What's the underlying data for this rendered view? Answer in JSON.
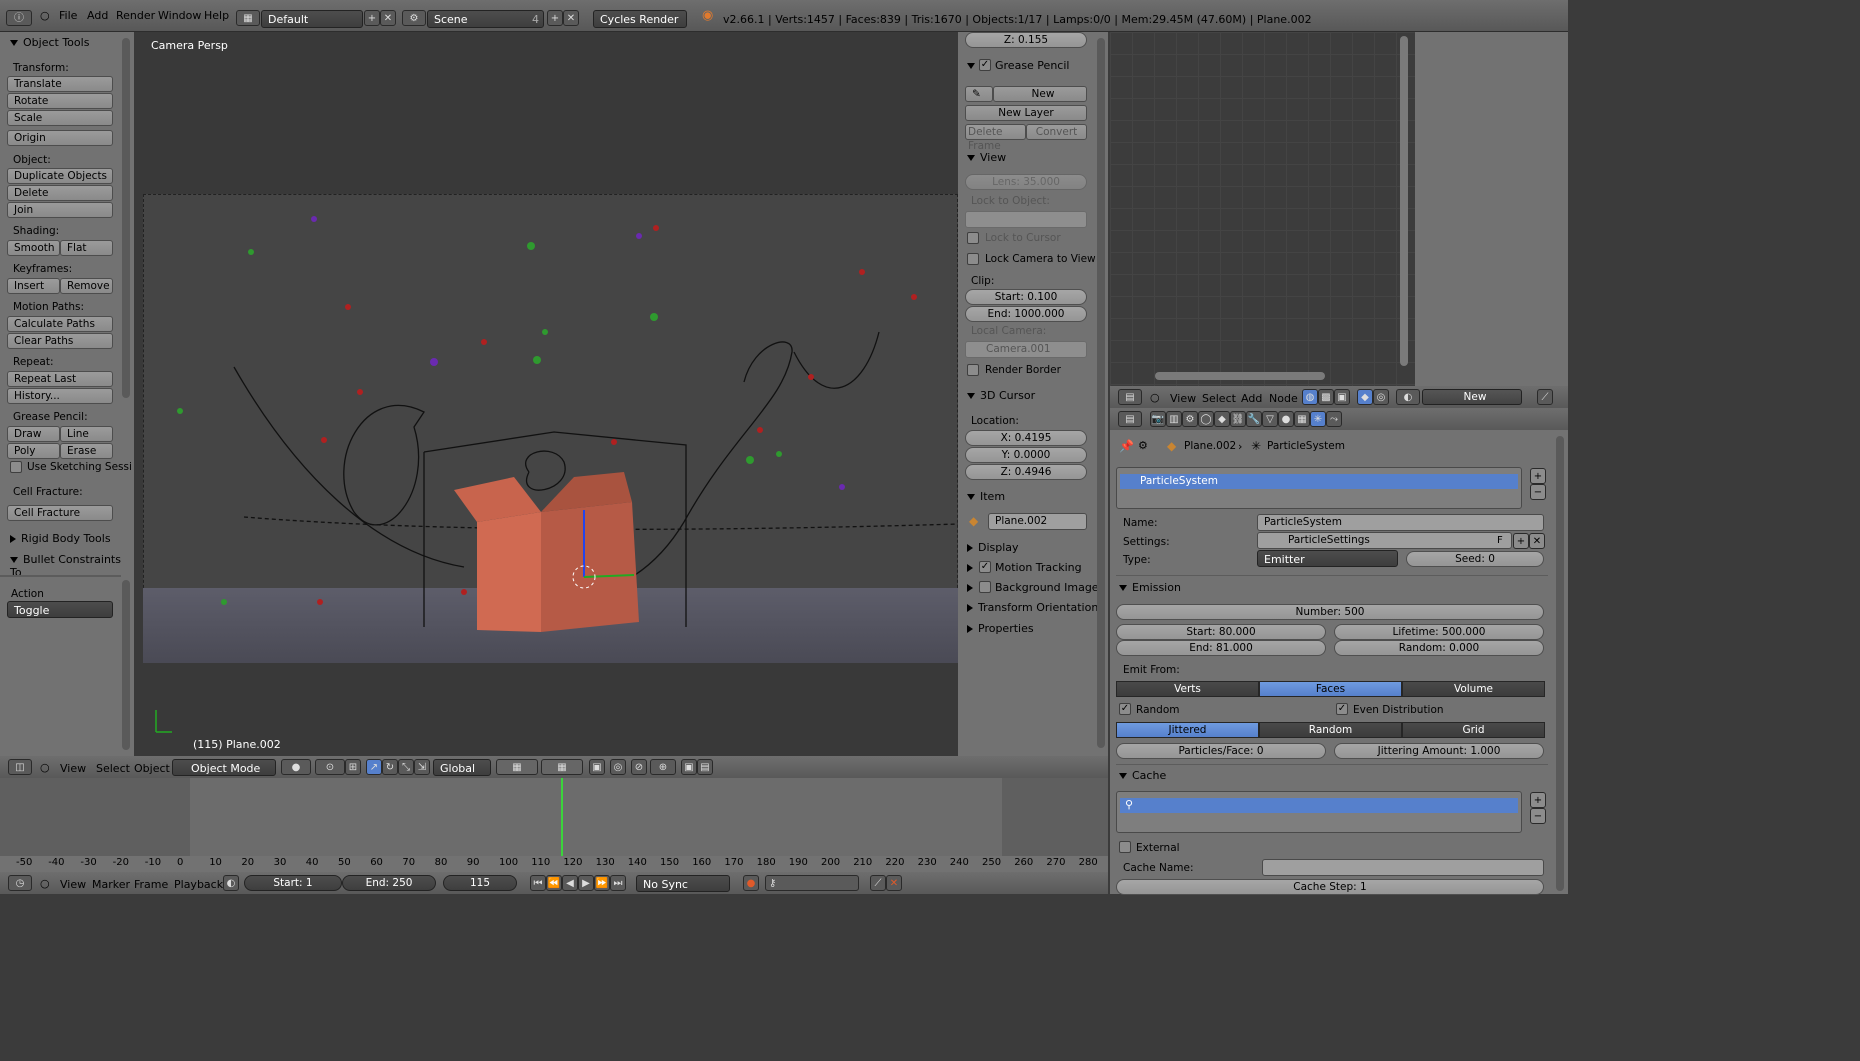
{
  "topbar": {
    "menus": [
      "File",
      "Add",
      "Render",
      "Window",
      "Help"
    ],
    "layout": "Default",
    "scene": "Scene",
    "scene_users": "4",
    "engine": "Cycles Render",
    "stats": "v2.66.1 | Verts:1457 | Faces:839 | Tris:1670 | Objects:1/17 | Lamps:0/0 | Mem:29.45M (47.60M) | Plane.002"
  },
  "tools": {
    "title": "Object Tools",
    "transform_label": "Transform:",
    "translate": "Translate",
    "rotate": "Rotate",
    "scale": "Scale",
    "origin": "Origin",
    "object_label": "Object:",
    "duplicate": "Duplicate Objects",
    "delete": "Delete",
    "join": "Join",
    "shading_label": "Shading:",
    "smooth": "Smooth",
    "flat": "Flat",
    "keyframes_label": "Keyframes:",
    "insert": "Insert",
    "remove": "Remove",
    "motion_label": "Motion Paths:",
    "calc_paths": "Calculate Paths",
    "clear_paths": "Clear Paths",
    "repeat_label": "Repeat:",
    "repeat_last": "Repeat Last",
    "history": "History...",
    "grease_label": "Grease Pencil:",
    "draw": "Draw",
    "line": "Line",
    "poly": "Poly",
    "erase": "Erase",
    "sketching": "Use Sketching Sessi",
    "fracture_label": "Cell Fracture:",
    "cell_fracture": "Cell Fracture",
    "rigid_body": "Rigid Body Tools",
    "bullet": "Bullet Constraints To",
    "action_label": "Action",
    "action_value": "Toggle"
  },
  "viewport": {
    "title": "Camera Persp",
    "object_label": "(115) Plane.002"
  },
  "view_header": {
    "menus": [
      "View",
      "Select",
      "Object"
    ],
    "mode": "Object Mode",
    "orientation": "Global"
  },
  "props": {
    "z_top": "Z: 0.155",
    "grease_title": "Grease Pencil",
    "new": "New",
    "new_layer": "New Layer",
    "delete_frame": "Delete Frame",
    "convert": "Convert",
    "view_title": "View",
    "lens": "Lens: 35.000",
    "lock_to_object": "Lock to Object:",
    "lock_to_cursor": "Lock to Cursor",
    "lock_camera": "Lock Camera to View",
    "clip_label": "Clip:",
    "clip_start": "Start: 0.100",
    "clip_end": "End: 1000.000",
    "local_camera": "Local Camera:",
    "camera_name": "Camera.001",
    "render_border": "Render Border",
    "cursor_title": "3D Cursor",
    "location_label": "Location:",
    "cx": "X: 0.4195",
    "cy": "Y: 0.0000",
    "cz": "Z: 0.4946",
    "item_title": "Item",
    "item_name": "Plane.002",
    "display": "Display",
    "motion_tracking": "Motion Tracking",
    "background_images": "Background Images",
    "transform_orient": "Transform Orientations",
    "properties": "Properties"
  },
  "node_header": {
    "menus": [
      "View",
      "Select",
      "Add",
      "Node"
    ],
    "new": "New"
  },
  "particles": {
    "crumb_object": "Plane.002",
    "crumb_system": "ParticleSystem",
    "list_item": "ParticleSystem",
    "name_label": "Name:",
    "name_value": "ParticleSystem",
    "settings_label": "Settings:",
    "settings_value": "ParticleSettings",
    "settings_flag": "F",
    "type_label": "Type:",
    "type_value": "Emitter",
    "seed": "Seed: 0",
    "emission_title": "Emission",
    "number": "Number: 500",
    "start": "Start: 80.000",
    "lifetime": "Lifetime: 500.000",
    "end": "End: 81.000",
    "random": "Random: 0.000",
    "emit_from": "Emit From:",
    "verts": "Verts",
    "faces": "Faces",
    "volume": "Volume",
    "random_chk": "Random",
    "even_dist": "Even Distribution",
    "jittered": "Jittered",
    "random_seg": "Random",
    "grid": "Grid",
    "per_face": "Particles/Face: 0",
    "jitter_amount": "Jittering Amount: 1.000",
    "cache_title": "Cache",
    "external": "External",
    "cache_name": "Cache Name:",
    "cache_step": "Cache Step: 1"
  },
  "timeline": {
    "ticks": [
      "-50",
      "-40",
      "-30",
      "-20",
      "-10",
      "0",
      "10",
      "20",
      "30",
      "40",
      "50",
      "60",
      "70",
      "80",
      "90",
      "100",
      "110",
      "120",
      "130",
      "140",
      "150",
      "160",
      "170",
      "180",
      "190",
      "200",
      "210",
      "220",
      "230",
      "240",
      "250",
      "260",
      "270",
      "280"
    ],
    "current_frame": 115
  },
  "footer": {
    "menus": [
      "View",
      "Marker",
      "Frame",
      "Playback"
    ],
    "start": "Start: 1",
    "end": "End: 250",
    "frame": "115",
    "sync": "No Sync"
  }
}
